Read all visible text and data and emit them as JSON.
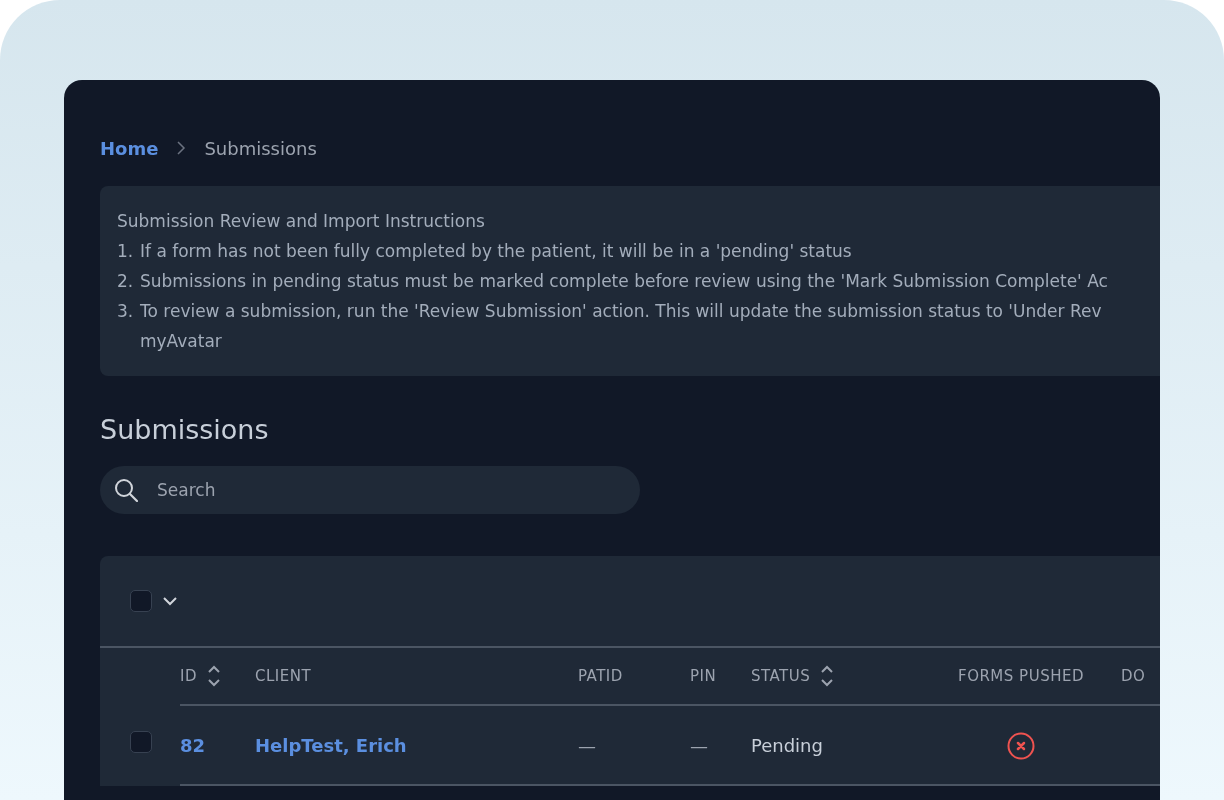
{
  "breadcrumb": [
    {
      "label": "Home",
      "kind": "link"
    },
    {
      "label": "Submissions",
      "kind": "current"
    }
  ],
  "instructions": {
    "title": "Submission Review and Import Instructions",
    "items": [
      {
        "number": "1.",
        "text": "If a form has not been fully completed by the patient, it will be in a 'pending' status"
      },
      {
        "number": "2.",
        "text": "Submissions in pending status must be marked complete before review using the 'Mark Submission Complete' Ac"
      },
      {
        "number": "3.",
        "text": "To review a submission, run the 'Review Submission' action. This will update the submission status to 'Under Rev",
        "continuation": "myAvatar"
      }
    ]
  },
  "heading": "Submissions",
  "search": {
    "placeholder": "Search"
  },
  "table": {
    "select_all": {
      "checked": false
    },
    "columns": [
      {
        "label": "ID",
        "sortable": true
      },
      {
        "label": "CLIENT",
        "sortable": false
      },
      {
        "label": "PATID",
        "sortable": false
      },
      {
        "label": "PIN",
        "sortable": false
      },
      {
        "label": "STATUS",
        "sortable": true
      },
      {
        "label": "FORMS PUSHED",
        "sortable": false
      },
      {
        "label": "DO",
        "sortable": false
      }
    ],
    "rows": [
      {
        "selected": false,
        "id": "82",
        "client": "HelpTest, Erich",
        "patid": "—",
        "pin": "—",
        "status": "Pending",
        "forms_pushed": false
      }
    ]
  }
}
